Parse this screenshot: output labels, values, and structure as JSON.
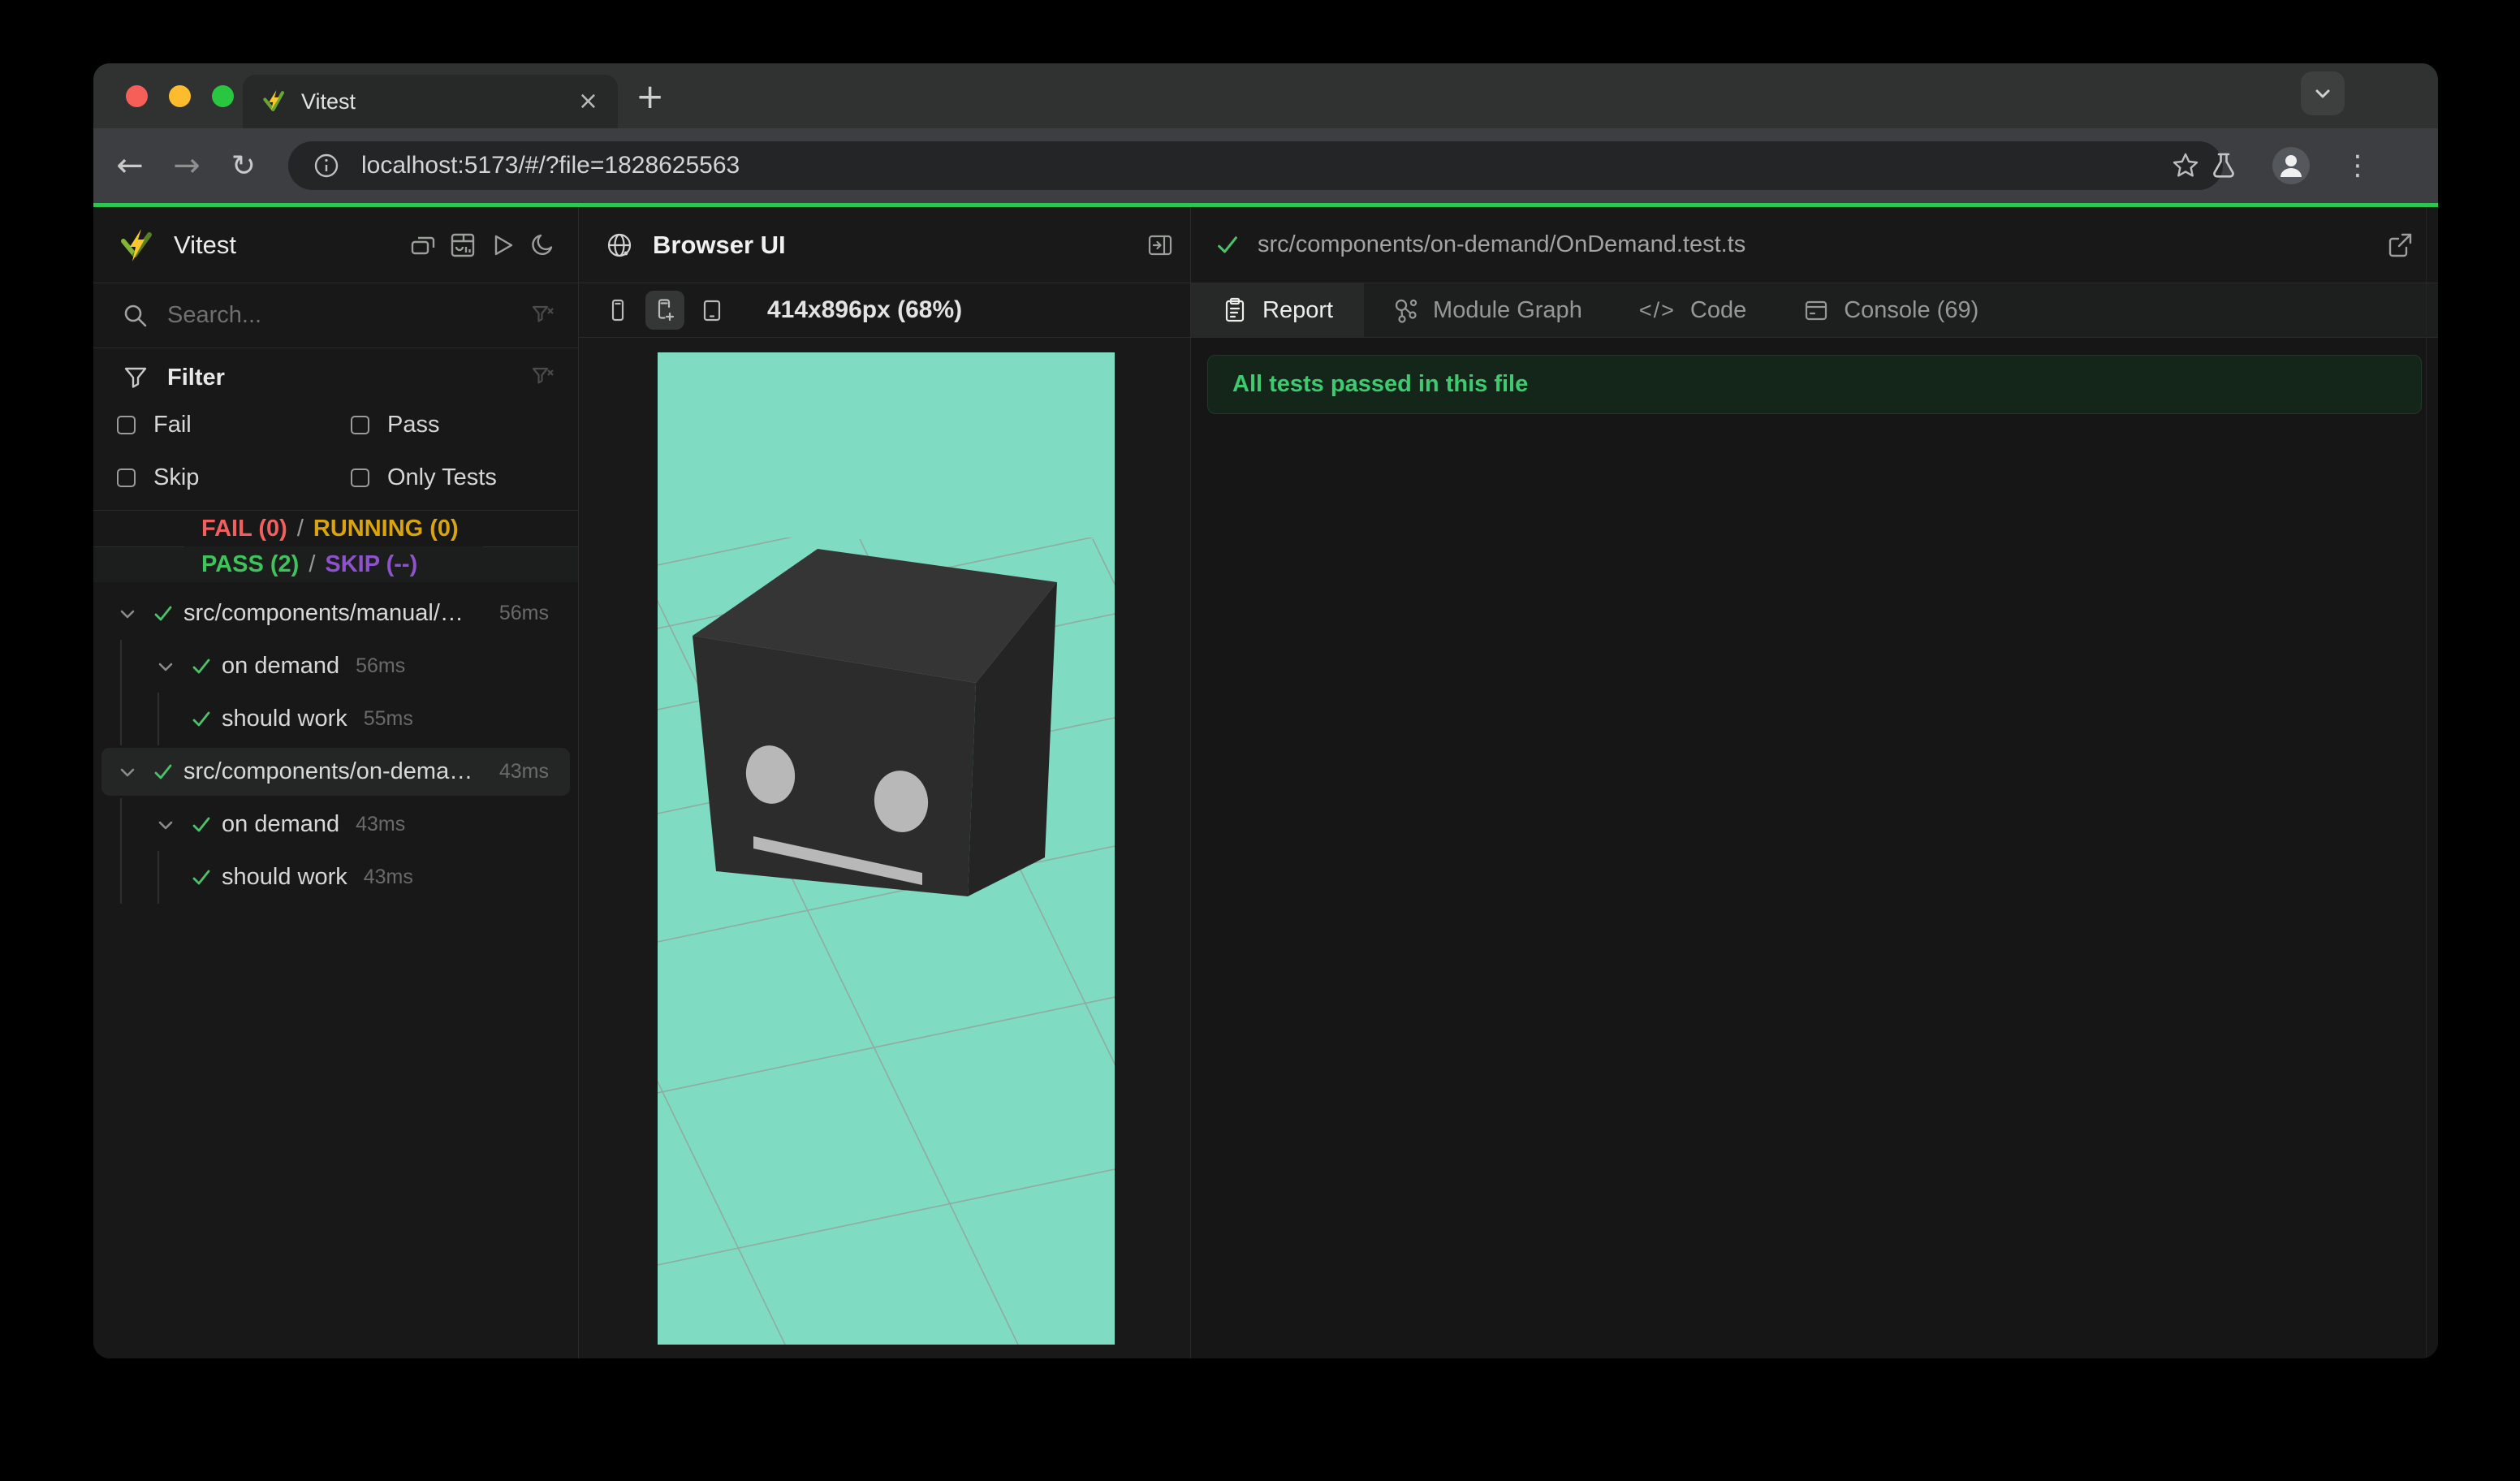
{
  "colors": {
    "accent": "#2dc653",
    "teal": "#7fdcc3",
    "fail": "#f25f5f",
    "running": "#d9a40f",
    "pass": "#3fc45c",
    "skip": "#8d52cc",
    "check": "#4cc36a",
    "banner_bg": "#142619",
    "banner_text": "#3ecb70"
  },
  "browser": {
    "tab_title": "Vitest",
    "url": "localhost:5173/#/?file=1828625563",
    "glyphs": {
      "close": "×",
      "new_tab": "+",
      "back": "←",
      "forward": "→",
      "reload": "↻",
      "menu": "⋮"
    }
  },
  "sidebar": {
    "title": "Vitest",
    "search_placeholder": "Search...",
    "filter": {
      "title": "Filter",
      "options": [
        "Fail",
        "Pass",
        "Skip",
        "Only Tests"
      ]
    },
    "stats": {
      "fail": "FAIL (0)",
      "running": "RUNNING (0)",
      "pass": "PASS (2)",
      "skip": "SKIP (--)",
      "sep": "/"
    },
    "tree": [
      {
        "type": "file",
        "label": "src/components/manual/…",
        "time": "56ms"
      },
      {
        "type": "suite",
        "label": "on demand",
        "time": "56ms"
      },
      {
        "type": "test",
        "label": "should work",
        "time": "55ms"
      },
      {
        "type": "file",
        "label": "src/components/on-dema…",
        "time": "43ms"
      },
      {
        "type": "suite",
        "label": "on demand",
        "time": "43ms"
      },
      {
        "type": "test",
        "label": "should work",
        "time": "43ms"
      }
    ]
  },
  "browser_panel": {
    "title": "Browser UI",
    "size_label": "414x896px (68%)"
  },
  "report_panel": {
    "file_path": "src/components/on-demand/OnDemand.test.ts",
    "code_glyph": "</>",
    "tabs": [
      {
        "label": "Report"
      },
      {
        "label": "Module Graph"
      },
      {
        "label": "Code"
      },
      {
        "label": "Console (69)"
      }
    ],
    "banner": "All tests passed in this file"
  }
}
